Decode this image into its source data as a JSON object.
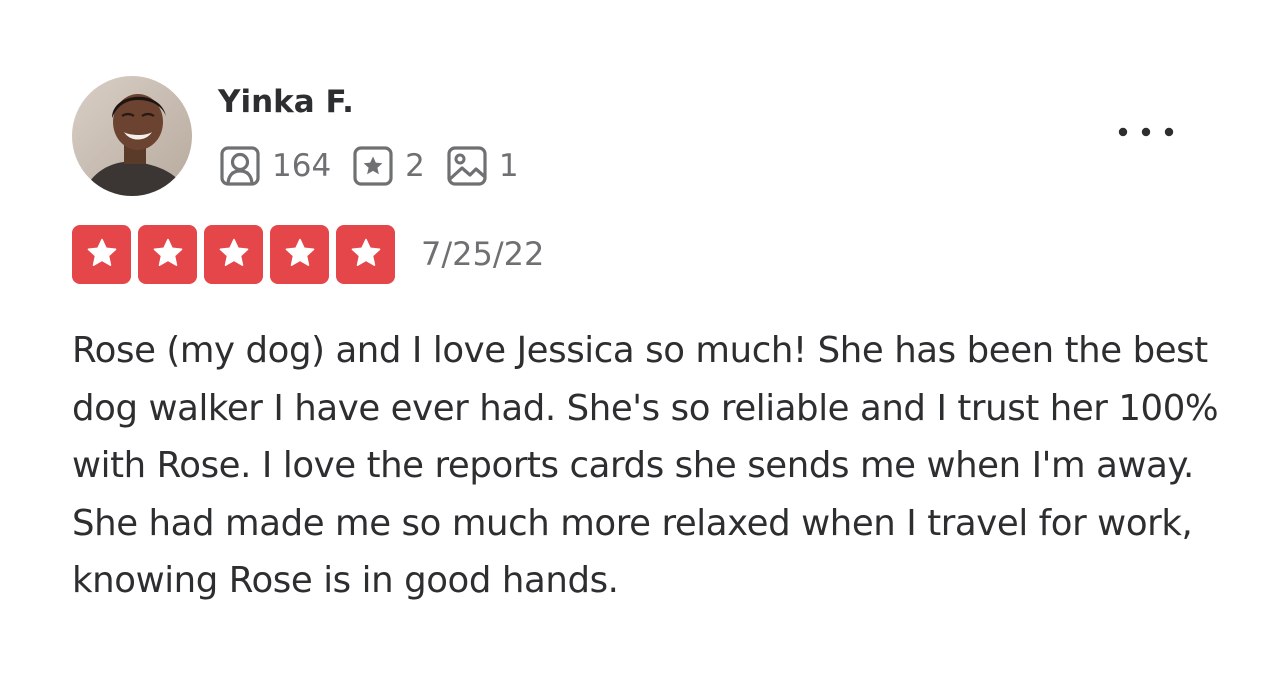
{
  "reviewer": {
    "name": "Yinka F.",
    "avatar": "reviewer-photo",
    "stats": [
      {
        "icon": "friends-icon",
        "count": "164"
      },
      {
        "icon": "reviews-star-icon",
        "count": "2"
      },
      {
        "icon": "photos-icon",
        "count": "1"
      }
    ]
  },
  "menu": {
    "icon": "more-options-icon"
  },
  "rating": {
    "stars": 5,
    "max": 5,
    "color": "#e4464a"
  },
  "date": "7/25/22",
  "body": "Rose (my dog) and I love Jessica so much! She has been the best dog walker I have ever had. She's so reliable and I trust her 100% with Rose. I love the reports cards she sends me when I'm away. She had made me so much more relaxed when I travel for work, knowing Rose is in good hands."
}
